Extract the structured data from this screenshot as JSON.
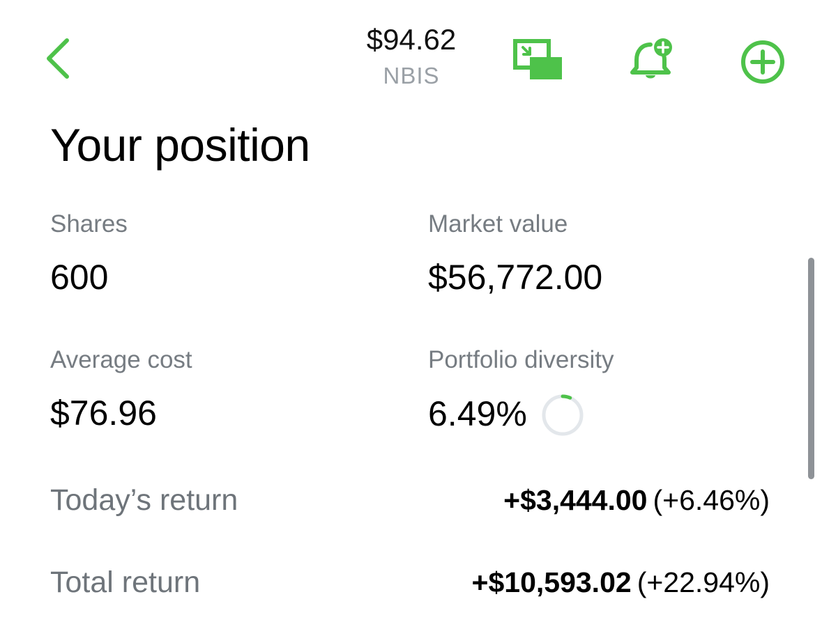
{
  "header": {
    "price": "$94.62",
    "ticker": "NBIS"
  },
  "icons": {
    "back": "chevron-left-icon",
    "pip": "picture-in-picture-icon",
    "alert": "bell-plus-icon",
    "add": "plus-circle-icon"
  },
  "colors": {
    "accent": "#4ec24a",
    "label": "#767c82",
    "ring_track": "#e3e7eb"
  },
  "position": {
    "title": "Your position",
    "shares": {
      "label": "Shares",
      "value": "600"
    },
    "market_value": {
      "label": "Market value",
      "value": "$56,772.00"
    },
    "average_cost": {
      "label": "Average cost",
      "value": "$76.96"
    },
    "portfolio_diversity": {
      "label": "Portfolio diversity",
      "value": "6.49%",
      "fraction": 0.0649
    },
    "todays_return": {
      "label": "Today’s return",
      "amount": "+$3,444.00",
      "percent": "(+6.46%)"
    },
    "total_return": {
      "label": "Total return",
      "amount": "+$10,593.02",
      "percent": "(+22.94%)"
    }
  }
}
